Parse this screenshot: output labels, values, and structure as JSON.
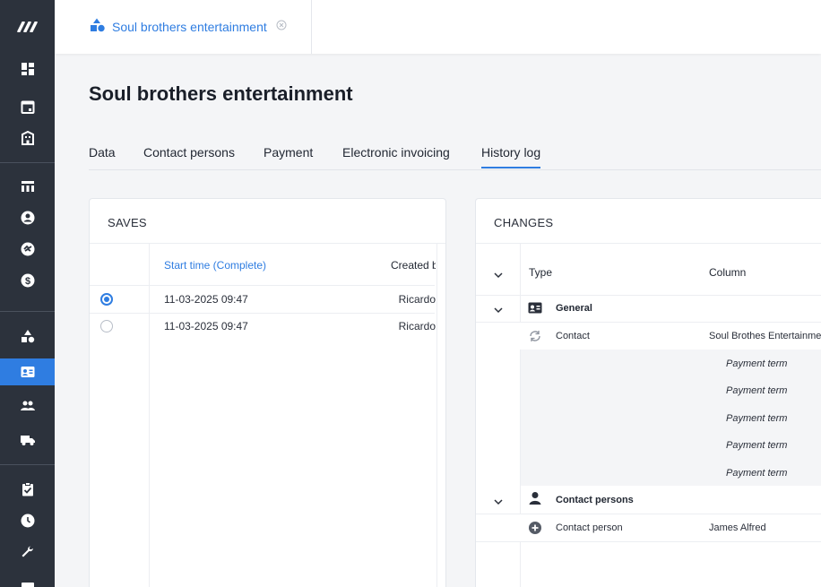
{
  "sidebar": {
    "logo": "logo-icon",
    "items": [
      {
        "icon": "dashboard-icon"
      },
      {
        "icon": "calendar-icon"
      },
      {
        "icon": "building-icon"
      },
      {
        "icon": "table-icon"
      },
      {
        "icon": "user-circle-icon"
      },
      {
        "icon": "handshake-icon"
      },
      {
        "icon": "dollar-icon"
      },
      {
        "icon": "shapes-icon"
      },
      {
        "icon": "contact-card-icon",
        "active": true
      },
      {
        "icon": "people-icon"
      },
      {
        "icon": "truck-icon"
      },
      {
        "icon": "clipboard-check-icon"
      },
      {
        "icon": "clock-icon"
      },
      {
        "icon": "wrench-icon"
      }
    ],
    "accent": "#2f7de1",
    "background": "#2c323c"
  },
  "topbar": {
    "tab_label": "Soul brothers entertainment",
    "tab_icon": "shapes-icon",
    "close_icon": "close-circle-icon"
  },
  "page": {
    "title": "Soul brothers entertainment",
    "tabs": [
      {
        "label": "Data"
      },
      {
        "label": "Contact persons"
      },
      {
        "label": "Payment"
      },
      {
        "label": "Electronic invoicing"
      },
      {
        "label": "History log",
        "active": true
      }
    ]
  },
  "saves": {
    "title": "SAVES",
    "columns": {
      "start": "Start time (Complete)",
      "created": "Created by"
    },
    "rows": [
      {
        "time": "11-03-2025 09:47",
        "creator": "Ricardo",
        "selected": true
      },
      {
        "time": "11-03-2025 09:47",
        "creator": "Ricardo",
        "selected": false
      }
    ]
  },
  "changes": {
    "title": "CHANGES",
    "columns": {
      "type": "Type",
      "column": "Column"
    },
    "groups": [
      {
        "label": "General",
        "icon": "contact-card-icon",
        "items": [
          {
            "label": "Contact",
            "icon": "sync-icon",
            "value": "Soul Brothes Entertainment"
          }
        ],
        "subitems": [
          "Payment term",
          "Payment term",
          "Payment term",
          "Payment term",
          "Payment term"
        ]
      },
      {
        "label": "Contact persons",
        "icon": "person-icon",
        "items": [
          {
            "label": "Contact person",
            "icon": "plus-circle-icon",
            "value": "James Alfred"
          }
        ]
      }
    ]
  }
}
